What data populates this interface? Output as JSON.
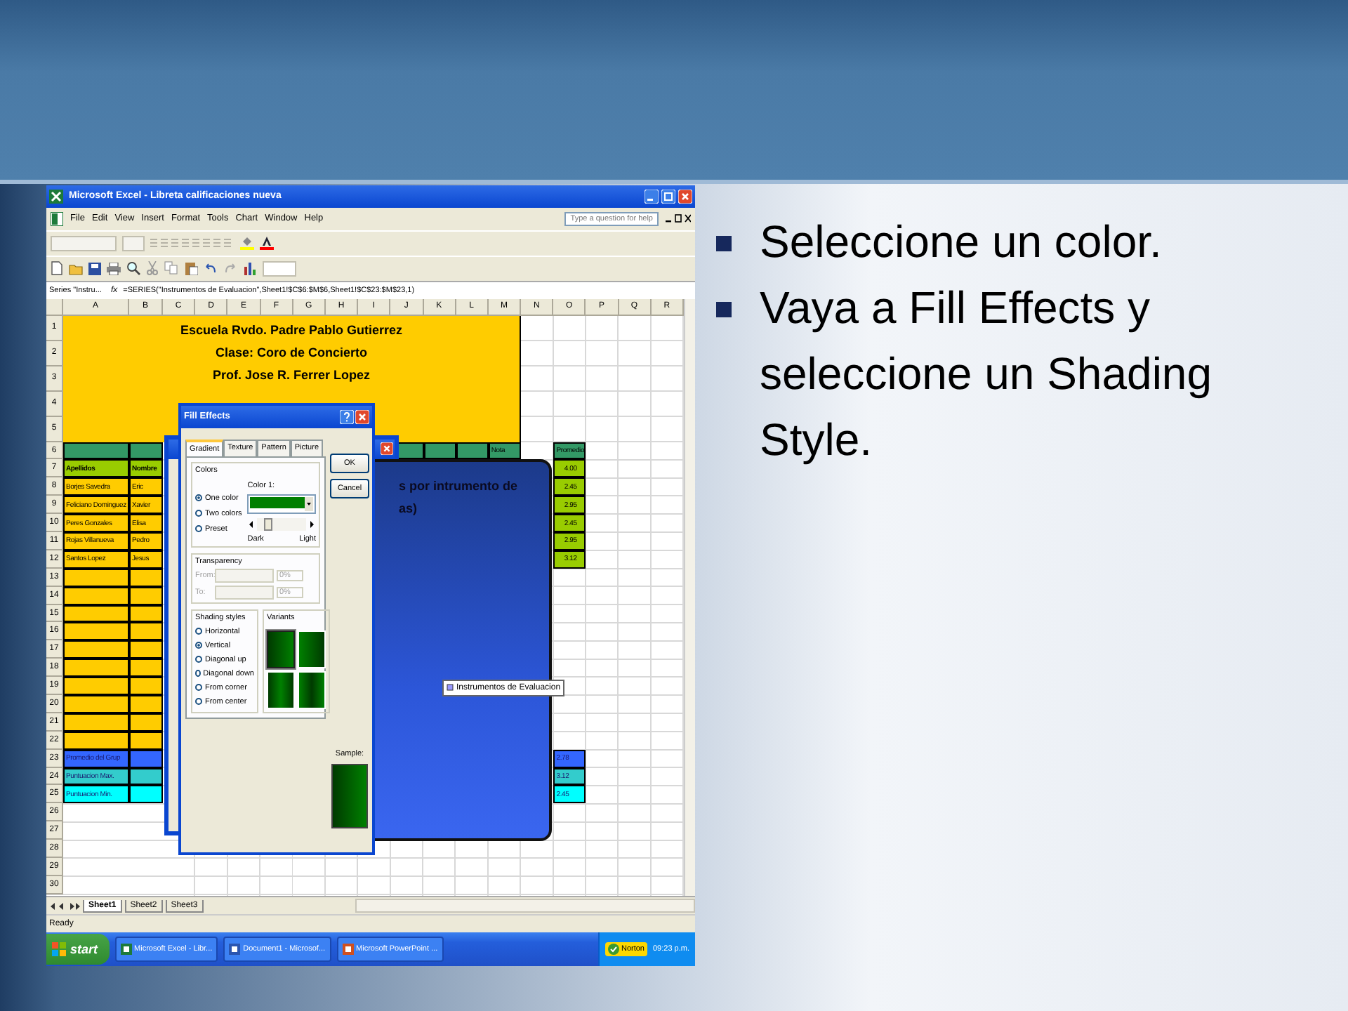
{
  "bullets": [
    "Seleccione un color.",
    "Vaya a Fill Effects y seleccione un Shading Style."
  ],
  "excel": {
    "title": "Microsoft Excel - Libreta calificaciones nueva",
    "menu": [
      "File",
      "Edit",
      "View",
      "Insert",
      "Format",
      "Tools",
      "Chart",
      "Window",
      "Help"
    ],
    "help_placeholder": "Type a question for help",
    "name_box": "Series \"Instru...",
    "function_symbol": "fx",
    "formula": "=SERIES(\"Instrumentos de Evaluacion\",Sheet1!$C$6:$M$6,Sheet1!$C$23:$M$23,1)",
    "columns": [
      "A",
      "B",
      "C",
      "D",
      "E",
      "F",
      "G",
      "H",
      "I",
      "J",
      "K",
      "L",
      "M",
      "N",
      "O",
      "P",
      "Q",
      "R"
    ],
    "title_lines": [
      "Escuela Rvdo. Padre Pablo Gutierrez",
      "Clase: Coro de Concierto",
      "Prof. Jose R. Ferrer Lopez"
    ],
    "rows": [
      {
        "number": "1"
      },
      {
        "number": "2"
      },
      {
        "number": "3"
      },
      {
        "number": "4"
      },
      {
        "number": "5"
      },
      {
        "number": "6",
        "A": {
          "kind": "header"
        },
        "B": {
          "kind": "header"
        },
        "J": {
          "kind": "header"
        },
        "K": {
          "kind": "header"
        },
        "L": {
          "kind": "header"
        },
        "M": {
          "kind": "header",
          "text": "Nota"
        },
        "O": {
          "kind": "header",
          "text": "Promedio"
        }
      },
      {
        "number": "7",
        "A": {
          "kind": "label",
          "text": "Apellidos"
        },
        "B": {
          "kind": "label",
          "text": "Nombre"
        },
        "O": {
          "kind": "score",
          "text": "4.00"
        }
      },
      {
        "number": "8",
        "A": {
          "kind": "name",
          "text": "Borjes Savedra"
        },
        "B": {
          "kind": "name",
          "text": "Eric"
        },
        "O": {
          "kind": "score",
          "text": "2.45"
        }
      },
      {
        "number": "9",
        "A": {
          "kind": "name",
          "text": "Feliciano Dominguez"
        },
        "B": {
          "kind": "name",
          "text": "Xavier"
        },
        "O": {
          "kind": "score",
          "text": "2.95"
        }
      },
      {
        "number": "10",
        "A": {
          "kind": "name",
          "text": "Peres Gonzales"
        },
        "B": {
          "kind": "name",
          "text": "Elisa"
        },
        "O": {
          "kind": "score",
          "text": "2.45"
        }
      },
      {
        "number": "11",
        "A": {
          "kind": "name",
          "text": "Rojas Villanueva"
        },
        "B": {
          "kind": "name",
          "text": "Pedro"
        },
        "O": {
          "kind": "score",
          "text": "2.95"
        }
      },
      {
        "number": "12",
        "A": {
          "kind": "name",
          "text": "Santos Lopez"
        },
        "B": {
          "kind": "name",
          "text": "Jesus"
        },
        "O": {
          "kind": "score",
          "text": "3.12"
        }
      },
      {
        "number": "13",
        "A": {
          "kind": "name"
        },
        "B": {
          "kind": "name"
        }
      },
      {
        "number": "14",
        "A": {
          "kind": "name"
        },
        "B": {
          "kind": "name"
        }
      },
      {
        "number": "15",
        "A": {
          "kind": "name"
        },
        "B": {
          "kind": "name"
        }
      },
      {
        "number": "16",
        "A": {
          "kind": "name"
        },
        "B": {
          "kind": "name"
        }
      },
      {
        "number": "17",
        "A": {
          "kind": "name"
        },
        "B": {
          "kind": "name"
        }
      },
      {
        "number": "18",
        "A": {
          "kind": "name"
        },
        "B": {
          "kind": "name"
        }
      },
      {
        "number": "19",
        "A": {
          "kind": "name"
        },
        "B": {
          "kind": "name"
        }
      },
      {
        "number": "20",
        "A": {
          "kind": "name"
        },
        "B": {
          "kind": "name"
        }
      },
      {
        "number": "21",
        "A": {
          "kind": "name"
        },
        "B": {
          "kind": "name"
        }
      },
      {
        "number": "22",
        "A": {
          "kind": "name"
        },
        "B": {
          "kind": "name"
        }
      },
      {
        "number": "23",
        "A": {
          "kind": "avg",
          "text": "Promedio del Grup"
        },
        "B": {
          "kind": "avg"
        },
        "O": {
          "kind": "avg",
          "text": "2.78"
        }
      },
      {
        "number": "24",
        "A": {
          "kind": "max",
          "text": "Puntuacion Max."
        },
        "B": {
          "kind": "max"
        },
        "O": {
          "kind": "max",
          "text": "3.12"
        }
      },
      {
        "number": "25",
        "A": {
          "kind": "min",
          "text": "Puntuacion Min."
        },
        "B": {
          "kind": "min"
        },
        "O": {
          "kind": "min",
          "text": "2.45"
        }
      },
      {
        "number": "26"
      },
      {
        "number": "27"
      },
      {
        "number": "28"
      },
      {
        "number": "29"
      },
      {
        "number": "30"
      }
    ],
    "sheet_tabs": [
      {
        "label": "Sheet1",
        "selected": true
      },
      {
        "label": "Sheet2",
        "selected": false
      },
      {
        "label": "Sheet3",
        "selected": false
      }
    ],
    "status": "Ready"
  },
  "chart": {
    "title_lines": [
      "s por intrumento de",
      "as)"
    ],
    "legend": "Instrumentos de Evaluacion"
  },
  "fill_effects": {
    "title": "Fill Effects",
    "tabs": [
      {
        "label": "Gradient",
        "selected": true
      },
      {
        "label": "Texture",
        "selected": false
      },
      {
        "label": "Pattern",
        "selected": false
      },
      {
        "label": "Picture",
        "selected": false
      }
    ],
    "colors_title": "Colors",
    "color_options": [
      {
        "label": "One color",
        "selected": true
      },
      {
        "label": "Two colors",
        "selected": false
      },
      {
        "label": "Preset",
        "selected": false
      }
    ],
    "color1": {
      "label": "Color 1:",
      "color": "#008000"
    },
    "shade": {
      "level": 0.15,
      "dark": "Dark",
      "light": "Light"
    },
    "transparency": {
      "title": "Transparency",
      "disabled": true,
      "rows": [
        {
          "label": "From:",
          "value": "0%"
        },
        {
          "label": "To:",
          "value": "0%"
        }
      ]
    },
    "shading_title": "Shading styles",
    "shading_styles": [
      {
        "label": "Horizontal",
        "selected": false
      },
      {
        "label": "Vertical",
        "selected": true
      },
      {
        "label": "Diagonal up",
        "selected": false
      },
      {
        "label": "Diagonal down",
        "selected": false
      },
      {
        "label": "From corner",
        "selected": false
      },
      {
        "label": "From center",
        "selected": false
      }
    ],
    "variants_title": "Variants",
    "variants": [
      {
        "kind": "dark_left",
        "selected": true
      },
      {
        "kind": "dark_right",
        "selected": false
      },
      {
        "kind": "dark_edges",
        "selected": false
      },
      {
        "kind": "light_edges",
        "selected": false
      }
    ],
    "sample_label": "Sample:",
    "buttons": [
      "OK",
      "Cancel"
    ]
  },
  "taskbar": {
    "start": "start",
    "items": [
      "Microsoft Excel - Libr...",
      "Document1 - Microsof...",
      "Microsoft PowerPoint ..."
    ],
    "norton": "Norton",
    "clock": "09:23 p.m."
  }
}
